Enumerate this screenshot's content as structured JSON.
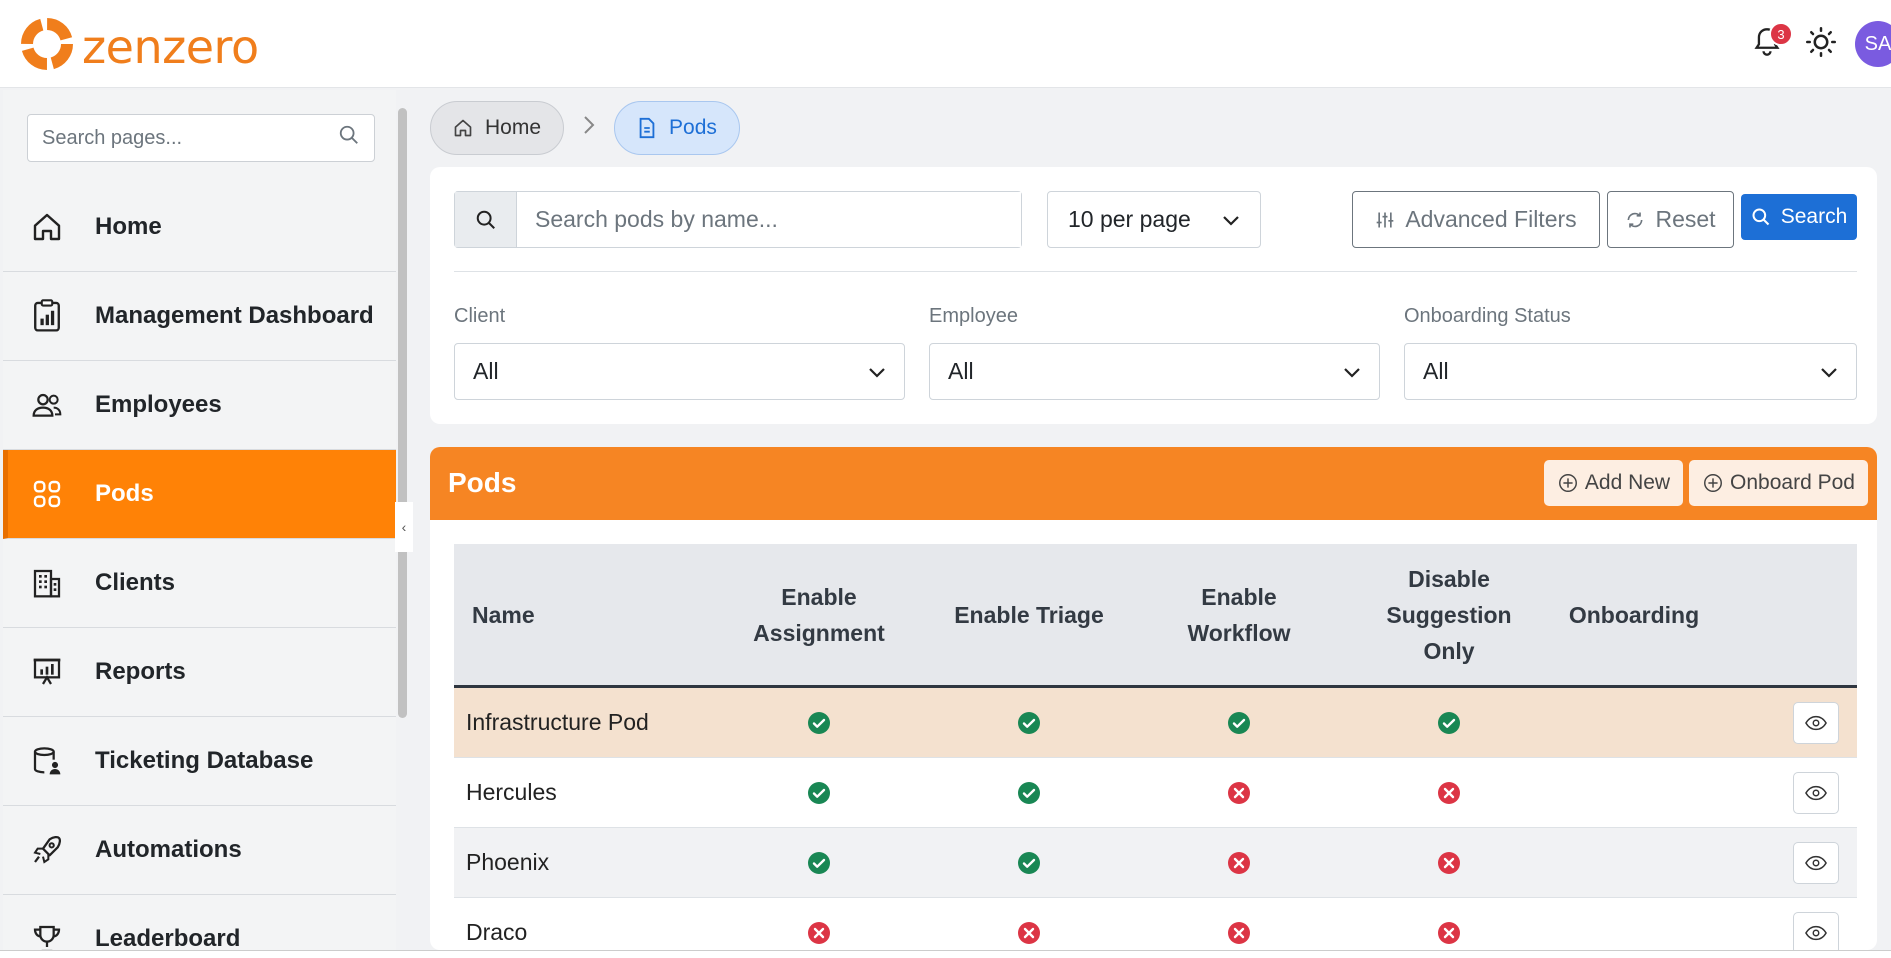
{
  "brand": {
    "name": "zenzero",
    "color": "#f07e1c"
  },
  "topbar": {
    "notification_count": "3",
    "avatar_initials": "SA"
  },
  "sidebar": {
    "search_placeholder": "Search pages...",
    "items": [
      {
        "label": "Home",
        "icon": "home-icon",
        "active": false
      },
      {
        "label": "Management Dashboard",
        "icon": "clipboard-chart-icon",
        "active": false
      },
      {
        "label": "Employees",
        "icon": "people-icon",
        "active": false
      },
      {
        "label": "Pods",
        "icon": "grid-icon",
        "active": true
      },
      {
        "label": "Clients",
        "icon": "building-icon",
        "active": false
      },
      {
        "label": "Reports",
        "icon": "presentation-chart-icon",
        "active": false
      },
      {
        "label": "Ticketing Database",
        "icon": "database-user-icon",
        "active": false
      },
      {
        "label": "Automations",
        "icon": "rocket-icon",
        "active": false
      },
      {
        "label": "Leaderboard",
        "icon": "trophy-icon",
        "active": false
      }
    ]
  },
  "breadcrumb": {
    "home": "Home",
    "current": "Pods"
  },
  "filters": {
    "search_placeholder": "Search pods by name...",
    "per_page": "10 per page",
    "advanced_filters": "Advanced Filters",
    "reset": "Reset",
    "search": "Search",
    "client_label": "Client",
    "client_value": "All",
    "employee_label": "Employee",
    "employee_value": "All",
    "onboarding_label": "Onboarding Status",
    "onboarding_value": "All"
  },
  "pods": {
    "title": "Pods",
    "add_new": "Add New",
    "onboard_pod": "Onboard Pod",
    "columns": {
      "name": "Name",
      "enable_assignment": "Enable Assignment",
      "enable_triage": "Enable Triage",
      "enable_workflow": "Enable Workflow",
      "disable_suggestion_only": "Disable Suggestion Only",
      "onboarding": "Onboarding"
    },
    "rows": [
      {
        "name": "Infrastructure Pod",
        "assignment": true,
        "triage": true,
        "workflow": true,
        "suggestion": true,
        "onboarding": ""
      },
      {
        "name": "Hercules",
        "assignment": true,
        "triage": true,
        "workflow": false,
        "suggestion": false,
        "onboarding": ""
      },
      {
        "name": "Phoenix",
        "assignment": true,
        "triage": true,
        "workflow": false,
        "suggestion": false,
        "onboarding": ""
      },
      {
        "name": "Draco",
        "assignment": false,
        "triage": false,
        "workflow": false,
        "suggestion": false,
        "onboarding": ""
      }
    ]
  },
  "colors": {
    "accent": "#ff8206",
    "header": "#f68523",
    "primary": "#1d6fd6",
    "success": "#198754",
    "danger": "#dc3545"
  }
}
